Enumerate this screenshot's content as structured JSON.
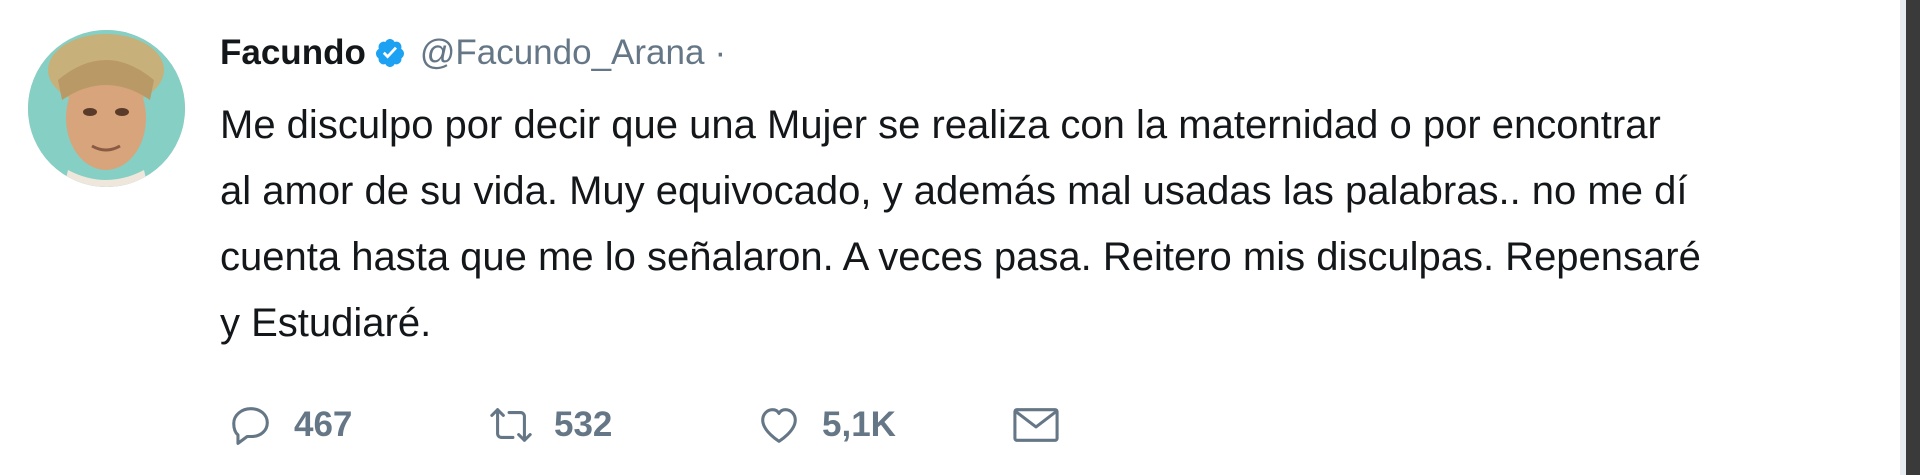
{
  "tweet": {
    "author": {
      "display_name": "Facundo",
      "handle": "@Facundo_Arana",
      "separator": "·",
      "verified": true,
      "avatar_icon": "profile-photo"
    },
    "text_lines": [
      "Me disculpo por decir que una Mujer se realiza con la maternidad o por encontrar",
      "al amor de su vida. Muy equivocado, y además mal usadas las palabras.. no me dí",
      "cuenta hasta que me lo señalaron. A veces pasa. Reitero mis disculpas. Repensaré",
      "y Estudiaré."
    ],
    "actions": {
      "reply": {
        "icon": "reply-icon",
        "count": "467"
      },
      "retweet": {
        "icon": "retweet-icon",
        "count": "532"
      },
      "like": {
        "icon": "heart-icon",
        "count": "5,1K"
      },
      "dm": {
        "icon": "envelope-icon"
      }
    }
  },
  "colors": {
    "text": "#14171a",
    "secondary": "#657786",
    "verified": "#1da1f2"
  }
}
